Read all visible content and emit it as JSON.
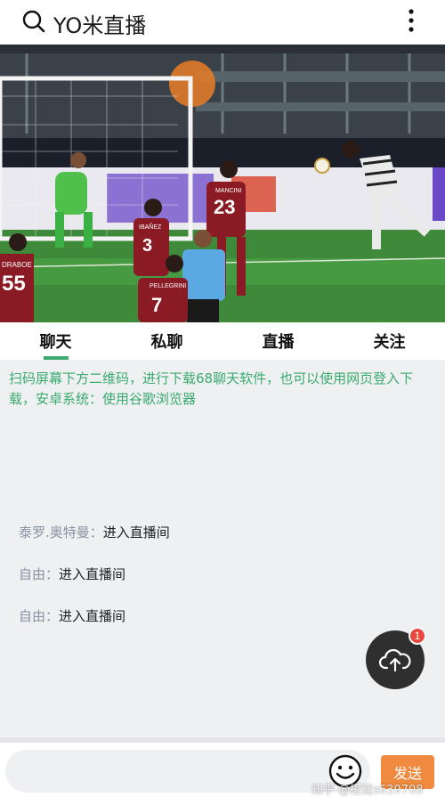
{
  "header": {
    "title": "YO米直播",
    "search_icon": "search-icon",
    "more_icon": "more-vertical-icon"
  },
  "video": {
    "jerseys": [
      "55",
      "DRABOE",
      "3",
      "IBAÑEZ",
      "23",
      "MANCINI",
      "7",
      "PELLEGRINI"
    ]
  },
  "tabs": [
    {
      "label": "聊天",
      "active": true
    },
    {
      "label": "私聊",
      "active": false
    },
    {
      "label": "直播",
      "active": false
    },
    {
      "label": "关注",
      "active": false
    }
  ],
  "chat": {
    "notice": "扫码屏幕下方二维码，进行下载68聊天软件，也可以使用网页登入下载，安卓系统：使用谷歌浏览器",
    "messages": [
      {
        "user": "泰罗.奥特曼",
        "sep": "：",
        "text": "进入直播间"
      },
      {
        "user": "自由",
        "sep": "：",
        "text": "进入直播间"
      },
      {
        "user": "自由",
        "sep": "：",
        "text": "进入直播间"
      }
    ],
    "upload_badge": "1"
  },
  "inputbar": {
    "placeholder": "",
    "send_label": "发送"
  },
  "watermark": "知乎 @搭建s639708",
  "colors": {
    "accent": "#3aaa6e",
    "send": "#f08a3e",
    "badge": "#e8483c"
  }
}
